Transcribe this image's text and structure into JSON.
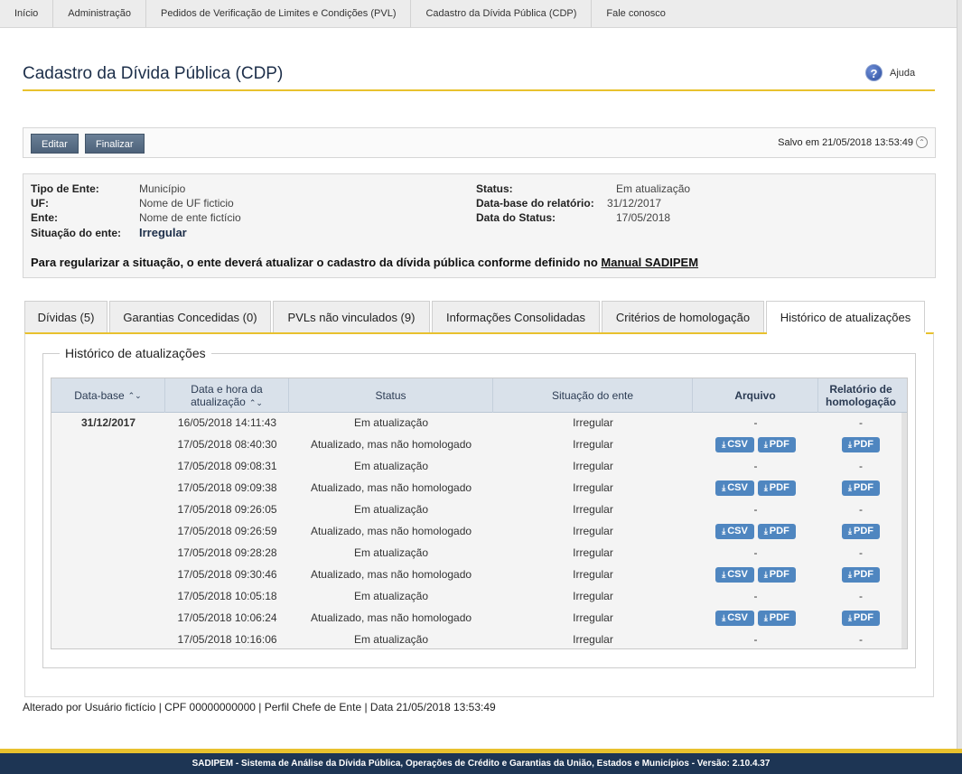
{
  "nav": [
    "Início",
    "Administração",
    "Pedidos de Verificação de Limites e Condições (PVL)",
    "Cadastro da Dívida Pública (CDP)",
    "Fale conosco"
  ],
  "header": {
    "title": "Cadastro da Dívida Pública (CDP)",
    "help_label": "Ajuda",
    "help_glyph": "?"
  },
  "toolbar": {
    "edit_label": "Editar",
    "finish_label": "Finalizar",
    "saved_text": "Salvo em 21/05/2018 13:53:49",
    "collapse_glyph": "⌃"
  },
  "info": {
    "tipo_label": "Tipo de Ente:",
    "tipo_value": "Município",
    "uf_label": "UF:",
    "uf_value": "Nome de UF ficticio",
    "ente_label": "Ente:",
    "ente_value": "Nome de ente fictício",
    "situacao_label": "Situação do ente:",
    "situacao_value": "Irregular",
    "status_label": "Status:",
    "status_value": "Em atualização",
    "database_label": "Data-base do relatório:",
    "database_value": "31/12/2017",
    "datastatus_label": "Data do Status:",
    "datastatus_value": "17/05/2018",
    "message": "Para regularizar a situação, o ente deverá atualizar o cadastro da dívida pública conforme definido no",
    "manual_link": "Manual SADIPEM"
  },
  "tabs": [
    "Dívidas (5)",
    "Garantias Concedidas (0)",
    "PVLs não vinculados (9)",
    "Informações Consolidadas",
    "Critérios de homologação",
    "Histórico de atualizações"
  ],
  "history": {
    "legend": "Histórico de atualizações",
    "headers": {
      "database": "Data-base",
      "datetime_1": "Data e hora da",
      "datetime_2": "atualização",
      "status": "Status",
      "situacao": "Situação do ente",
      "arquivo": "Arquivo",
      "relatorio_1": "Relatório de",
      "relatorio_2": "homologação",
      "sort_glyph": "⌃⌄"
    },
    "csv_label": "CSV",
    "pdf_label": "PDF",
    "download_glyph": "⤓",
    "empty": "-",
    "database_value": "31/12/2017",
    "rows": [
      {
        "datetime": "16/05/2018 14:11:43",
        "status": "Em atualização",
        "situacao": "Irregular",
        "files": false
      },
      {
        "datetime": "17/05/2018 08:40:30",
        "status": "Atualizado, mas não homologado",
        "situacao": "Irregular",
        "files": true
      },
      {
        "datetime": "17/05/2018 09:08:31",
        "status": "Em atualização",
        "situacao": "Irregular",
        "files": false
      },
      {
        "datetime": "17/05/2018 09:09:38",
        "status": "Atualizado, mas não homologado",
        "situacao": "Irregular",
        "files": true
      },
      {
        "datetime": "17/05/2018 09:26:05",
        "status": "Em atualização",
        "situacao": "Irregular",
        "files": false
      },
      {
        "datetime": "17/05/2018 09:26:59",
        "status": "Atualizado, mas não homologado",
        "situacao": "Irregular",
        "files": true
      },
      {
        "datetime": "17/05/2018 09:28:28",
        "status": "Em atualização",
        "situacao": "Irregular",
        "files": false
      },
      {
        "datetime": "17/05/2018 09:30:46",
        "status": "Atualizado, mas não homologado",
        "situacao": "Irregular",
        "files": true
      },
      {
        "datetime": "17/05/2018 10:05:18",
        "status": "Em atualização",
        "situacao": "Irregular",
        "files": false
      },
      {
        "datetime": "17/05/2018 10:06:24",
        "status": "Atualizado, mas não homologado",
        "situacao": "Irregular",
        "files": true
      },
      {
        "datetime": "17/05/2018 10:16:06",
        "status": "Em atualização",
        "situacao": "Irregular",
        "files": false
      }
    ]
  },
  "altered_text": "Alterado por Usuário fictício | CPF 00000000000 | Perfil Chefe de Ente | Data 21/05/2018 13:53:49",
  "footer_text": "SADIPEM - Sistema de Análise da Dívida Pública, Operações de Crédito e Garantias da União, Estados e Municípios - Versão: 2.10.4.37",
  "colors": {
    "accent": "#e8c12e",
    "navy": "#1d3554",
    "button_blue": "#4f86c0"
  }
}
